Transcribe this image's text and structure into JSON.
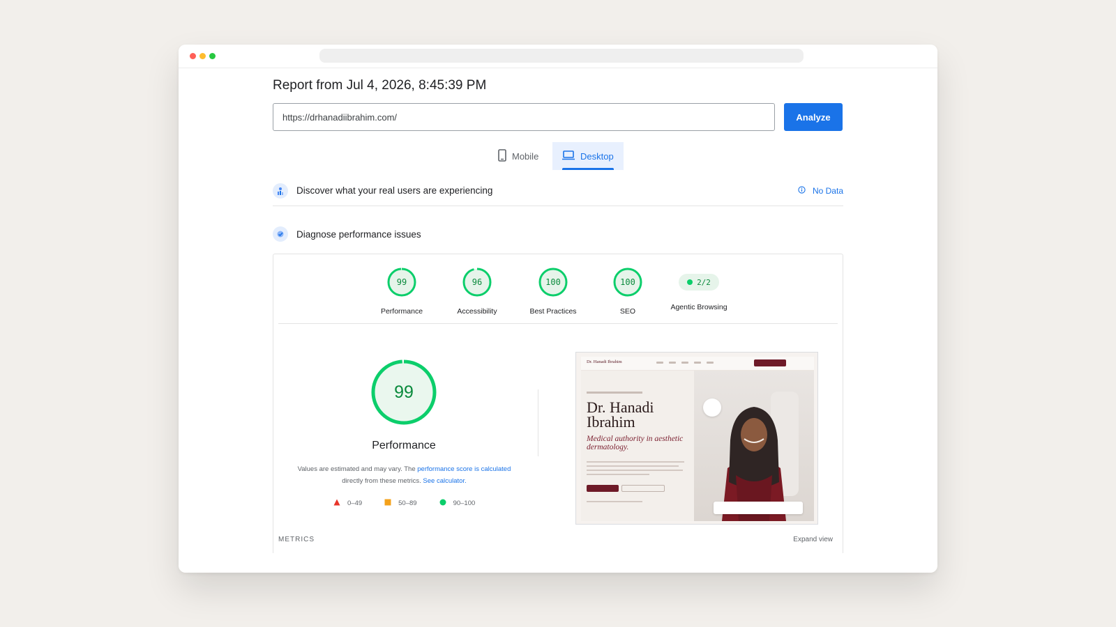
{
  "report": {
    "title": "Report from Jul 4, 2026, 8:45:39 PM"
  },
  "url_input": {
    "value": "https://drhanadiibrahim.com/"
  },
  "analyze_label": "Analyze",
  "tabs": [
    {
      "label": "Mobile",
      "icon": "phone-icon",
      "selected": false
    },
    {
      "label": "Desktop",
      "icon": "laptop-icon",
      "selected": true
    }
  ],
  "field_data": {
    "text": "Discover what your real users are experiencing",
    "status": "No Data"
  },
  "diagnose": {
    "text": "Diagnose performance issues"
  },
  "scores": [
    {
      "label": "Performance",
      "value": "99",
      "fraction": 0.99
    },
    {
      "label": "Accessibility",
      "value": "96",
      "fraction": 0.96
    },
    {
      "label": "Best Practices",
      "value": "100",
      "fraction": 1.0
    },
    {
      "label": "SEO",
      "value": "100",
      "fraction": 1.0
    }
  ],
  "agentic": {
    "label": "Agentic Browsing",
    "value": "2/2"
  },
  "performance": {
    "score": "99",
    "fraction": 0.99,
    "label": "Performance",
    "desc_1": "Values are estimated and may vary. The ",
    "desc_link_1": "performance score is calculated",
    "desc_2": "directly from these metrics. ",
    "desc_link_2": "See calculator."
  },
  "legend": [
    {
      "range": "0–49",
      "color": "#e8352a",
      "shape": "triangle"
    },
    {
      "range": "50–89",
      "color": "#f4a11b",
      "shape": "square"
    },
    {
      "range": "90–100",
      "color": "#0cce6b",
      "shape": "circle"
    }
  ],
  "metrics": {
    "label": "METRICS",
    "expand": "Expand view"
  },
  "thumbnail": {
    "logo": "Dr. Hanadi Ibrahim",
    "name": "Dr. Hanadi Ibrahim",
    "tagline": "Medical authority in aesthetic dermatology."
  },
  "colors": {
    "accent": "#1a73e8",
    "pass": "#0cce6b",
    "pass_text": "#0a8a3c",
    "pass_bg": "#e6f4ea",
    "brand": "#6e1a28"
  }
}
